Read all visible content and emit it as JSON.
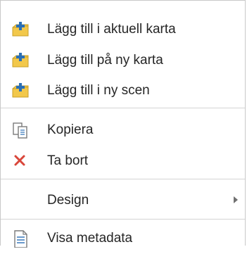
{
  "menu": {
    "items": [
      {
        "label": "Lägg till i aktuell karta",
        "icon": "add-layer-icon"
      },
      {
        "label": "Lägg till på ny karta",
        "icon": "add-layer-icon"
      },
      {
        "label": "Lägg till i ny scen",
        "icon": "add-layer-icon"
      },
      {
        "label": "Kopiera",
        "icon": "copy-icon"
      },
      {
        "label": "Ta bort",
        "icon": "delete-icon"
      },
      {
        "label": "Design",
        "icon": "",
        "has_submenu": true
      },
      {
        "label": "Visa metadata",
        "icon": "metadata-icon"
      }
    ]
  },
  "colors": {
    "folder_yellow": "#f2c84b",
    "plus_blue": "#2a6fb5",
    "delete_red": "#d9463a",
    "text": "#262626",
    "separator": "#d4d4d4"
  }
}
